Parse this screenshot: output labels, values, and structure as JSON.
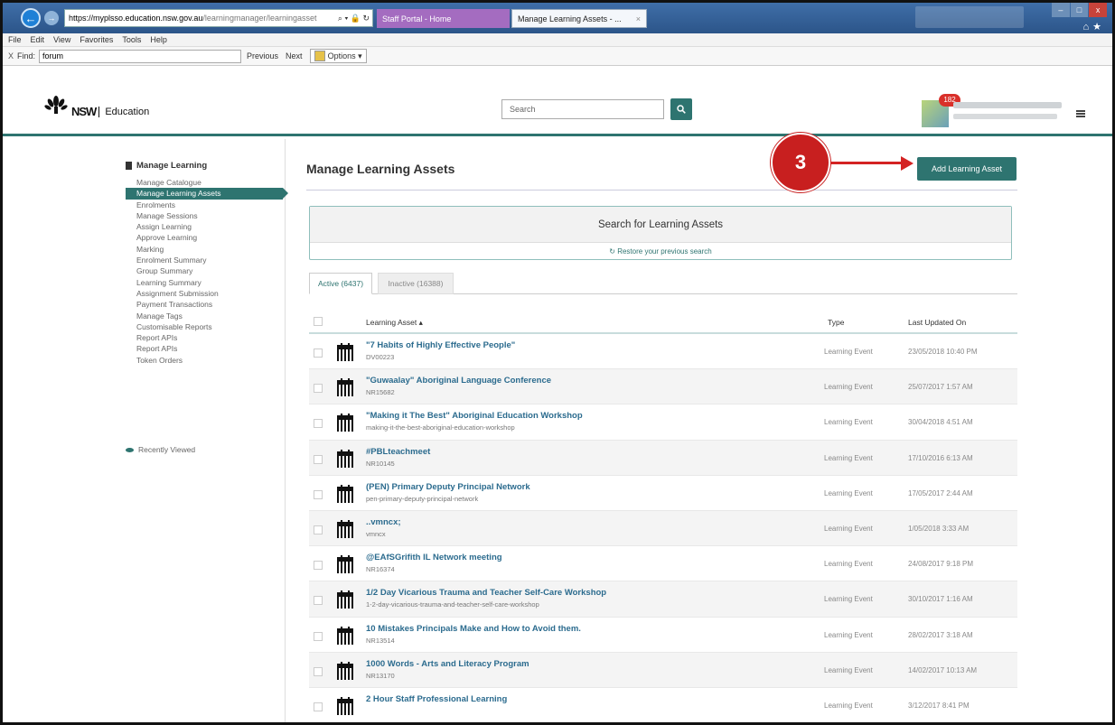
{
  "browser": {
    "url_host": "https://myplsso.education.nsw.gov.au",
    "url_rest": "/learningmanager/learningasset",
    "url_controls": "⌕ ▾ 🔒 ↻",
    "tabs": [
      {
        "label": "Staff Portal - Home"
      },
      {
        "label": "Manage Learning Assets - ...",
        "close": "×"
      }
    ],
    "menu": [
      "File",
      "Edit",
      "View",
      "Favorites",
      "Tools",
      "Help"
    ],
    "find": {
      "close": "X",
      "label": "Find:",
      "value": "forum",
      "previous": "Previous",
      "next": "Next",
      "options": "Options ▾"
    }
  },
  "header": {
    "logo_nsw": "NSW",
    "logo_text": "Education",
    "search_placeholder": "Search",
    "notification_count": "182"
  },
  "sidebar": {
    "title": "Manage Learning",
    "items": [
      "Manage Catalogue",
      "Manage Learning Assets",
      "Enrolments",
      "Manage Sessions",
      "Assign Learning",
      "Approve Learning",
      "Marking",
      "Enrolment Summary",
      "Group Summary",
      "Learning Summary",
      "Assignment Submission",
      "Payment Transactions",
      "Manage Tags",
      "Customisable Reports",
      "Report APIs",
      "Report APIs",
      "Token Orders"
    ],
    "recently_viewed": "Recently Viewed"
  },
  "main": {
    "title": "Manage Learning Assets",
    "add_button": "Add Learning Asset",
    "step_marker": "3",
    "search_panel_title": "Search for Learning Assets",
    "restore_search": "↻ Restore your previous search",
    "tabs": [
      {
        "label": "Active (6437)"
      },
      {
        "label": "Inactive (16388)"
      }
    ],
    "columns": {
      "asset": "Learning Asset ▴",
      "type": "Type",
      "updated": "Last Updated On"
    },
    "rows": [
      {
        "title": "\"7 Habits of Highly Effective People\"",
        "code": "DV00223",
        "type": "Learning Event",
        "date": "23/05/2018 10:40 PM"
      },
      {
        "title": "\"Guwaalay\" Aboriginal Language Conference",
        "code": "NR15682",
        "type": "Learning Event",
        "date": "25/07/2017 1:57 AM"
      },
      {
        "title": "\"Making it The Best\" Aboriginal Education Workshop",
        "code": "making-it-the-best-aboriginal-education-workshop",
        "type": "Learning Event",
        "date": "30/04/2018 4:51 AM"
      },
      {
        "title": "#PBLteachmeet",
        "code": "NR10145",
        "type": "Learning Event",
        "date": "17/10/2016 6:13 AM"
      },
      {
        "title": "(PEN) Primary Deputy Principal Network",
        "code": "pen-primary-deputy-principal-network",
        "type": "Learning Event",
        "date": "17/05/2017 2:44 AM"
      },
      {
        "title": "..vmncx;",
        "code": "vmncx",
        "type": "Learning Event",
        "date": "1/05/2018 3:33 AM"
      },
      {
        "title": "@EAfSGrifith IL Network meeting",
        "code": "NR16374",
        "type": "Learning Event",
        "date": "24/08/2017 9:18 PM"
      },
      {
        "title": "1/2 Day Vicarious Trauma and Teacher Self-Care Workshop",
        "code": "1-2-day-vicarious-trauma-and-teacher-self-care-workshop",
        "type": "Learning Event",
        "date": "30/10/2017 1:16 AM"
      },
      {
        "title": "10 Mistakes Principals Make and How to Avoid them.",
        "code": "NR13514",
        "type": "Learning Event",
        "date": "28/02/2017 3:18 AM"
      },
      {
        "title": "1000 Words - Arts and Literacy Program",
        "code": "NR13170",
        "type": "Learning Event",
        "date": "14/02/2017 10:13 AM"
      },
      {
        "title": "2 Hour Staff Professional Learning",
        "code": "",
        "type": "Learning Event",
        "date": "3/12/2017 8:41 PM"
      }
    ]
  },
  "colors": {
    "brand": "#2e7470",
    "link": "#2b6b8e",
    "annotation": "#c81f1f"
  }
}
